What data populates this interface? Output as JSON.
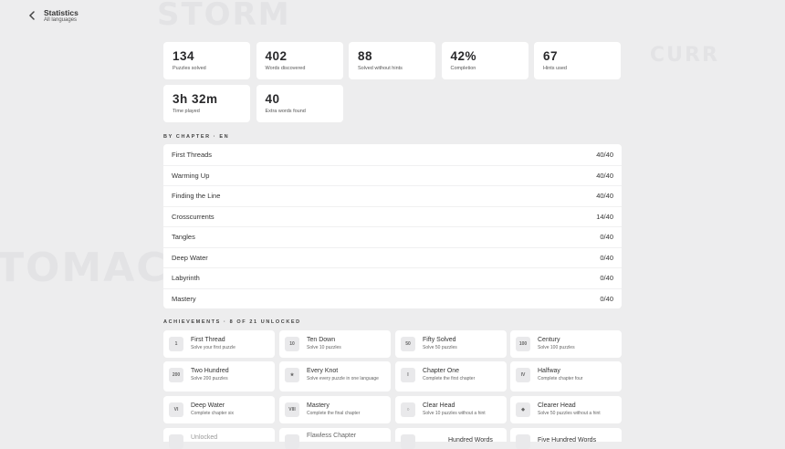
{
  "background_words": [
    "STORM",
    "CURR",
    "TOMACH"
  ],
  "header": {
    "title": "Statistics",
    "subtitle": "All languages"
  },
  "stats": [
    {
      "value": "134",
      "label": "Puzzles solved"
    },
    {
      "value": "402",
      "label": "Words discovered"
    },
    {
      "value": "88",
      "label": "Solved without hints"
    },
    {
      "value": "42%",
      "label": "Completion"
    },
    {
      "value": "67",
      "label": "Hints used"
    },
    {
      "value": "3h 32m",
      "label": "Time played"
    },
    {
      "value": "40",
      "label": "Extra words found"
    }
  ],
  "chapters_section": {
    "heading": "BY CHAPTER · EN",
    "rows": [
      {
        "name": "First Threads",
        "progress": "40/40"
      },
      {
        "name": "Warming Up",
        "progress": "40/40"
      },
      {
        "name": "Finding the Line",
        "progress": "40/40"
      },
      {
        "name": "Crosscurrents",
        "progress": "14/40"
      },
      {
        "name": "Tangles",
        "progress": "0/40"
      },
      {
        "name": "Deep Water",
        "progress": "0/40"
      },
      {
        "name": "Labyrinth",
        "progress": "0/40"
      },
      {
        "name": "Mastery",
        "progress": "0/40"
      }
    ]
  },
  "achievements_section": {
    "heading": "ACHIEVEMENTS · 8 OF 21 UNLOCKED",
    "items": [
      {
        "badge": "1",
        "title": "First Thread",
        "desc": "Solve your first puzzle"
      },
      {
        "badge": "10",
        "title": "Ten Down",
        "desc": "Solve 10 puzzles"
      },
      {
        "badge": "50",
        "title": "Fifty Solved",
        "desc": "Solve 50 puzzles"
      },
      {
        "badge": "100",
        "title": "Century",
        "desc": "Solve 100 puzzles"
      },
      {
        "badge": "200",
        "title": "Two Hundred",
        "desc": "Solve 200 puzzles"
      },
      {
        "badge": "★",
        "title": "Every Knot",
        "desc": "Solve every puzzle in one language"
      },
      {
        "badge": "I",
        "title": "Chapter One",
        "desc": "Complete the first chapter"
      },
      {
        "badge": "IV",
        "title": "Halfway",
        "desc": "Complete chapter four"
      },
      {
        "badge": "VI",
        "title": "Deep Water",
        "desc": "Complete chapter six"
      },
      {
        "badge": "VIII",
        "title": "Mastery",
        "desc": "Complete the final chapter"
      },
      {
        "badge": "○",
        "title": "Clear Head",
        "desc": "Solve 10 puzzles without a hint"
      },
      {
        "badge": "◆",
        "title": "Clearer Head",
        "desc": "Solve 50 puzzles without a hint"
      },
      {
        "badge": "",
        "title": "Unlocked",
        "desc": ""
      },
      {
        "badge": "",
        "title": "Flawless Chapter",
        "desc": ""
      },
      {
        "badge": "",
        "title": "Hundred Words",
        "desc": ""
      },
      {
        "badge": "",
        "title": "Five Hundred Words",
        "desc": ""
      }
    ]
  }
}
